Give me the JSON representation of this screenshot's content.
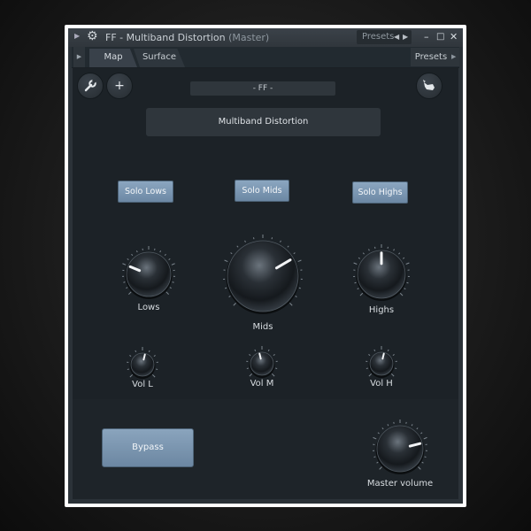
{
  "window": {
    "title": "FF - Multiband Distortion",
    "subtitle": "(Master)",
    "presets_label": "Presets",
    "prev_icon": "◀",
    "next_icon": "▶",
    "minimize_icon": "–",
    "maximize_icon": "□",
    "close_icon": "✕"
  },
  "tabs": [
    {
      "label": "Map",
      "active": true
    },
    {
      "label": "Surface",
      "active": false
    }
  ],
  "tabbar": {
    "presets_label": "Presets"
  },
  "toolbar": {
    "wrench_icon": "wrench-icon",
    "plus_label": "+",
    "animal_icon": "cat-icon"
  },
  "preset_bar": {
    "label": "- FF -"
  },
  "name_box": {
    "label": "Multiband Distortion"
  },
  "solo": {
    "lows": "Solo Lows",
    "mids": "Solo Mids",
    "highs": "Solo Highs"
  },
  "knobs": {
    "lows": {
      "label": "Lows",
      "value": 0.25
    },
    "mids": {
      "label": "Mids",
      "value": 0.72
    },
    "highs": {
      "label": "Highs",
      "value": 0.5
    },
    "vol_l": {
      "label": "Vol L",
      "value": 0.55
    },
    "vol_m": {
      "label": "Vol M",
      "value": 0.45
    },
    "vol_h": {
      "label": "Vol H",
      "value": 0.55
    },
    "master": {
      "label": "Master volume",
      "value": 0.78
    }
  },
  "bypass": {
    "label": "Bypass"
  },
  "colors": {
    "accent": "#7c97b2",
    "panel": "#1c2227",
    "window": "#2b3238"
  }
}
